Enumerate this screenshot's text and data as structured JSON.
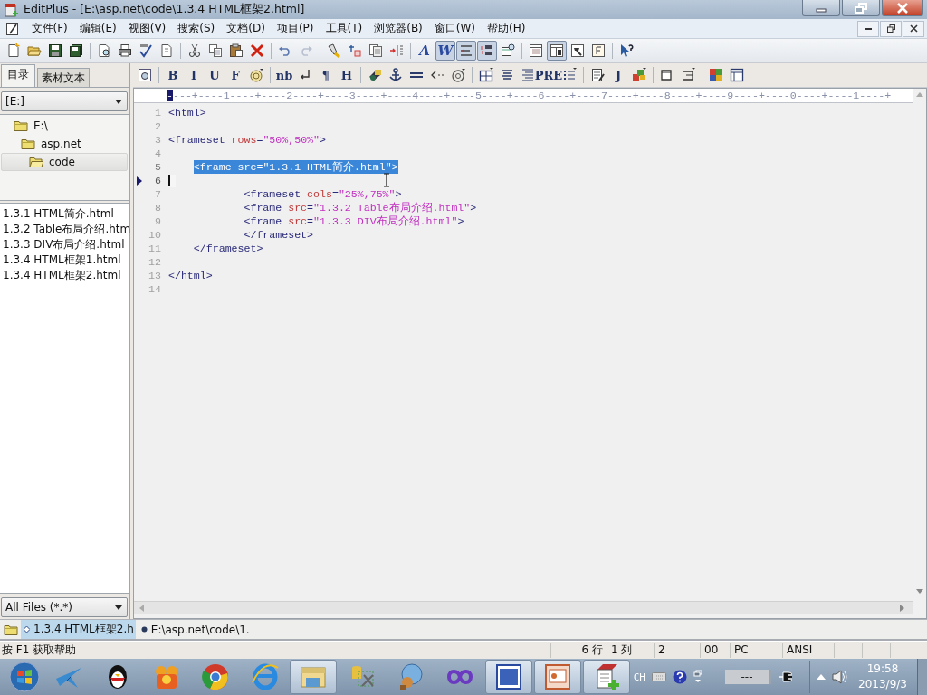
{
  "window": {
    "title": "EditPlus - [E:\\asp.net\\code\\1.3.4 HTML框架2.html]"
  },
  "menu": [
    "文件(F)",
    "编辑(E)",
    "视图(V)",
    "搜索(S)",
    "文档(D)",
    "项目(P)",
    "工具(T)",
    "浏览器(B)",
    "窗口(W)",
    "帮助(H)"
  ],
  "toolbar_main": [
    {
      "kind": "icon",
      "pressed": false
    },
    {
      "kind": "icon",
      "pressed": false
    },
    {
      "kind": "icon",
      "pressed": false
    },
    {
      "kind": "icon",
      "pressed": false
    },
    {
      "kind": "separator"
    },
    {
      "kind": "icon",
      "pressed": false
    },
    {
      "kind": "icon",
      "pressed": false
    },
    {
      "kind": "icon",
      "pressed": false
    },
    {
      "kind": "icon",
      "pressed": false
    },
    {
      "kind": "separator"
    },
    {
      "kind": "icon",
      "pressed": false
    },
    {
      "kind": "icon",
      "pressed": false
    },
    {
      "kind": "icon",
      "pressed": false
    },
    {
      "kind": "icon",
      "pressed": false
    },
    {
      "kind": "separator"
    },
    {
      "kind": "icon",
      "pressed": false
    },
    {
      "kind": "icon",
      "pressed": false
    },
    {
      "kind": "separator"
    },
    {
      "kind": "icon",
      "pressed": false
    },
    {
      "kind": "icon",
      "pressed": false
    },
    {
      "kind": "icon",
      "pressed": false
    },
    {
      "kind": "icon",
      "pressed": false
    },
    {
      "kind": "separator"
    },
    {
      "kind": "text",
      "label": "A",
      "pressed": false
    },
    {
      "kind": "text",
      "label": "W",
      "pressed": true
    },
    {
      "kind": "icon",
      "pressed": true
    },
    {
      "kind": "icon",
      "pressed": true
    },
    {
      "kind": "icon",
      "pressed": false
    },
    {
      "kind": "separator"
    },
    {
      "kind": "icon",
      "pressed": false
    },
    {
      "kind": "icon",
      "pressed": true
    },
    {
      "kind": "icon",
      "pressed": false
    },
    {
      "kind": "icon",
      "pressed": false
    },
    {
      "kind": "separator"
    },
    {
      "kind": "icon",
      "pressed": false
    }
  ],
  "toolbar_html": [
    {
      "kind": "icon"
    },
    {
      "kind": "separator"
    },
    {
      "kind": "text",
      "label": "B"
    },
    {
      "kind": "text",
      "label": "I"
    },
    {
      "kind": "text",
      "label": "U"
    },
    {
      "kind": "text",
      "label": "F"
    },
    {
      "kind": "icon"
    },
    {
      "kind": "separator"
    },
    {
      "kind": "text",
      "label": "nb"
    },
    {
      "kind": "icon"
    },
    {
      "kind": "text",
      "label": "¶"
    },
    {
      "kind": "text",
      "label": "H"
    },
    {
      "kind": "separator"
    },
    {
      "kind": "icon"
    },
    {
      "kind": "icon"
    },
    {
      "kind": "icon"
    },
    {
      "kind": "icon"
    },
    {
      "kind": "icon"
    },
    {
      "kind": "separator"
    },
    {
      "kind": "icon"
    },
    {
      "kind": "icon"
    },
    {
      "kind": "icon"
    },
    {
      "kind": "text",
      "label": "PRE"
    },
    {
      "kind": "icon"
    },
    {
      "kind": "separator"
    },
    {
      "kind": "icon"
    },
    {
      "kind": "text",
      "label": "J"
    },
    {
      "kind": "icon"
    },
    {
      "kind": "separator"
    },
    {
      "kind": "icon"
    },
    {
      "kind": "icon"
    },
    {
      "kind": "separator"
    },
    {
      "kind": "icon"
    },
    {
      "kind": "icon"
    }
  ],
  "sidebar": {
    "tabs": [
      {
        "label": "目录",
        "selected": true
      },
      {
        "label": "素材文本",
        "selected": false
      }
    ],
    "drive": "[E:]",
    "tree": [
      {
        "label": "E:\\",
        "selected": false,
        "children": [
          {
            "label": "asp.net",
            "selected": false,
            "children": [
              {
                "label": "code",
                "selected": true
              }
            ]
          }
        ]
      }
    ],
    "files": [
      "1.3.1 HTML简介.html",
      "1.3.2 Table布局介绍.htm",
      "1.3.3 DIV布局介绍.html",
      "1.3.4 HTML框架1.html",
      "1.3.4 HTML框架2.html"
    ],
    "filter": "All Files (*.*)"
  },
  "editor": {
    "ruler": "----+----1----+----2----+----3----+----4----+----5----+----6----+----7----+----8----+----9----+----0----+----1----+",
    "lines": [
      {
        "number": "1",
        "selected": false,
        "current": false,
        "segments": [
          {
            "kind": "tag",
            "text": "<html>"
          }
        ]
      },
      {
        "number": "2",
        "selected": false,
        "current": false
      },
      {
        "number": "3",
        "selected": false,
        "current": false,
        "segments": [
          {
            "kind": "tag",
            "text": "<frameset "
          },
          {
            "kind": "attr",
            "text": "rows"
          },
          {
            "kind": "tag",
            "text": "="
          },
          {
            "kind": "value",
            "text": "\"50%,50%\""
          },
          {
            "kind": "tag",
            "text": ">"
          }
        ]
      },
      {
        "number": "4",
        "selected": false,
        "current": false
      },
      {
        "number": "5",
        "selected": true,
        "current": false,
        "segments": [
          {
            "kind": "tag",
            "text": "    <frame "
          },
          {
            "kind": "attr",
            "text": "src"
          },
          {
            "kind": "tag",
            "text": "="
          },
          {
            "kind": "value",
            "text": "\"1.3.1 HTML简介.html\""
          },
          {
            "kind": "tag",
            "text": ">"
          }
        ]
      },
      {
        "number": "6",
        "selected": false,
        "current": true
      },
      {
        "number": "7",
        "selected": false,
        "current": false,
        "segments": [
          {
            "kind": "tag",
            "text": "            <frameset "
          },
          {
            "kind": "attr",
            "text": "cols"
          },
          {
            "kind": "tag",
            "text": "="
          },
          {
            "kind": "value",
            "text": "\"25%,75%\""
          },
          {
            "kind": "tag",
            "text": ">"
          }
        ]
      },
      {
        "number": "8",
        "selected": false,
        "current": false,
        "segments": [
          {
            "kind": "tag",
            "text": "            <frame "
          },
          {
            "kind": "attr",
            "text": "src"
          },
          {
            "kind": "tag",
            "text": "="
          },
          {
            "kind": "value",
            "text": "\"1.3.2 Table布局介绍.html\""
          },
          {
            "kind": "tag",
            "text": ">"
          }
        ]
      },
      {
        "number": "9",
        "selected": false,
        "current": false,
        "segments": [
          {
            "kind": "tag",
            "text": "            <frame "
          },
          {
            "kind": "attr",
            "text": "src"
          },
          {
            "kind": "tag",
            "text": "="
          },
          {
            "kind": "value",
            "text": "\"1.3.3 DIV布局介绍.html\""
          },
          {
            "kind": "tag",
            "text": ">"
          }
        ]
      },
      {
        "number": "10",
        "selected": false,
        "current": false,
        "segments": [
          {
            "kind": "tag",
            "text": "            </frameset>"
          }
        ]
      },
      {
        "number": "11",
        "selected": false,
        "current": false,
        "segments": [
          {
            "kind": "tag",
            "text": "    </frameset>"
          }
        ]
      },
      {
        "number": "12",
        "selected": false,
        "current": false
      },
      {
        "number": "13",
        "selected": false,
        "current": false,
        "segments": [
          {
            "kind": "tag",
            "text": "</html>"
          }
        ]
      },
      {
        "number": "14",
        "selected": false,
        "current": false
      }
    ]
  },
  "document_tabs": [
    {
      "label": "1.3.4 HTML框架2.h",
      "selected": true
    },
    {
      "label": "E:\\asp.net\\code\\1.",
      "selected": false
    }
  ],
  "status_bar": {
    "hint": "按 F1 获取帮助",
    "cells": [
      "6 行",
      "1 列",
      "2",
      "00",
      "PC",
      "ANSI"
    ]
  },
  "taskbar": {
    "apps": [
      {
        "active": false
      },
      {
        "active": false
      },
      {
        "active": false
      },
      {
        "active": false
      },
      {
        "active": false
      },
      {
        "active": true
      },
      {
        "active": false
      },
      {
        "active": false
      },
      {
        "active": false
      },
      {
        "active": true
      },
      {
        "active": true
      },
      {
        "active": true
      }
    ],
    "language": "CH",
    "battery": "---",
    "time": "19:58",
    "date": "2013/9/3"
  }
}
